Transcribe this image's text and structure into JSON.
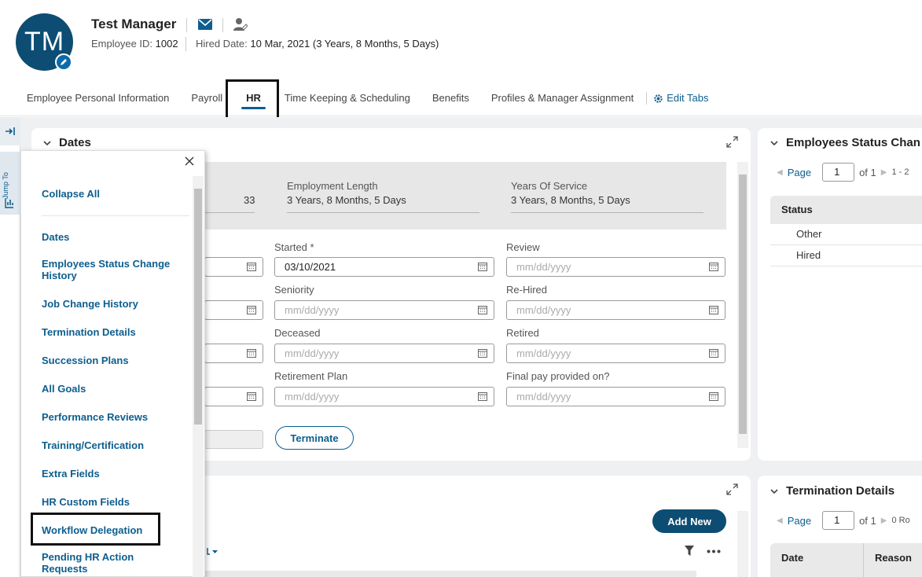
{
  "employee": {
    "initials": "TM",
    "name": "Test Manager",
    "employee_id_label": "Employee ID:",
    "employee_id": "1002",
    "hired_label": "Hired Date:",
    "hired_value": "10 Mar, 2021 (3 Years, 8 Months, 5 Days)"
  },
  "tabs": [
    {
      "label": "Employee Personal Information"
    },
    {
      "label": "Payroll"
    },
    {
      "label": "HR"
    },
    {
      "label": "Time Keeping & Scheduling"
    },
    {
      "label": "Benefits"
    },
    {
      "label": "Profiles & Manager Assignment"
    }
  ],
  "active_tab": "HR",
  "edit_tabs_label": "Edit Tabs",
  "rail": {
    "jump_to_label": "Jump To"
  },
  "dates_card": {
    "title": "Dates",
    "summary": {
      "first_value": "33",
      "employment_length_label": "Employment Length",
      "employment_length_value": "3 Years, 8 Months, 5 Days",
      "years_service_label": "Years Of Service",
      "years_service_value": "3 Years, 8 Months, 5 Days"
    },
    "fields": {
      "started_label": "Started",
      "started_required": "*",
      "started_value": "03/10/2021",
      "review_label": "Review",
      "seniority_label": "Seniority",
      "rehired_label": "Re-Hired",
      "deceased_label": "Deceased",
      "retired_label": "Retired",
      "retirement_plan_label": "Retirement Plan",
      "final_pay_label": "Final pay provided on?",
      "placeholder": "mm/dd/yyyy"
    },
    "terminate_label": "Terminate"
  },
  "lower_card": {
    "add_new_label": "Add New"
  },
  "status_card": {
    "title": "Employees Status Chan",
    "pager": {
      "page_label": "Page",
      "page_value": "1",
      "of_label": "of 1",
      "range": "1 - 2"
    },
    "column": "Status",
    "rows": [
      "Other",
      "Hired"
    ]
  },
  "termination_card": {
    "title": "Termination Details",
    "pager": {
      "page_label": "Page",
      "page_value": "1",
      "of_label": "of 1",
      "range": "0 Ro"
    },
    "columns": [
      "Date",
      "Reason"
    ]
  },
  "jump_panel": {
    "close_symbol": "X",
    "collapse_all": "Collapse All",
    "items": [
      "Dates",
      "Employees Status Change History",
      "Job Change History",
      "Termination Details",
      "Succession Plans",
      "All Goals",
      "Performance Reviews",
      "Training/Certification",
      "Extra Fields",
      "HR Custom Fields",
      "Workflow Delegation",
      "Pending HR Action Requests"
    ]
  }
}
